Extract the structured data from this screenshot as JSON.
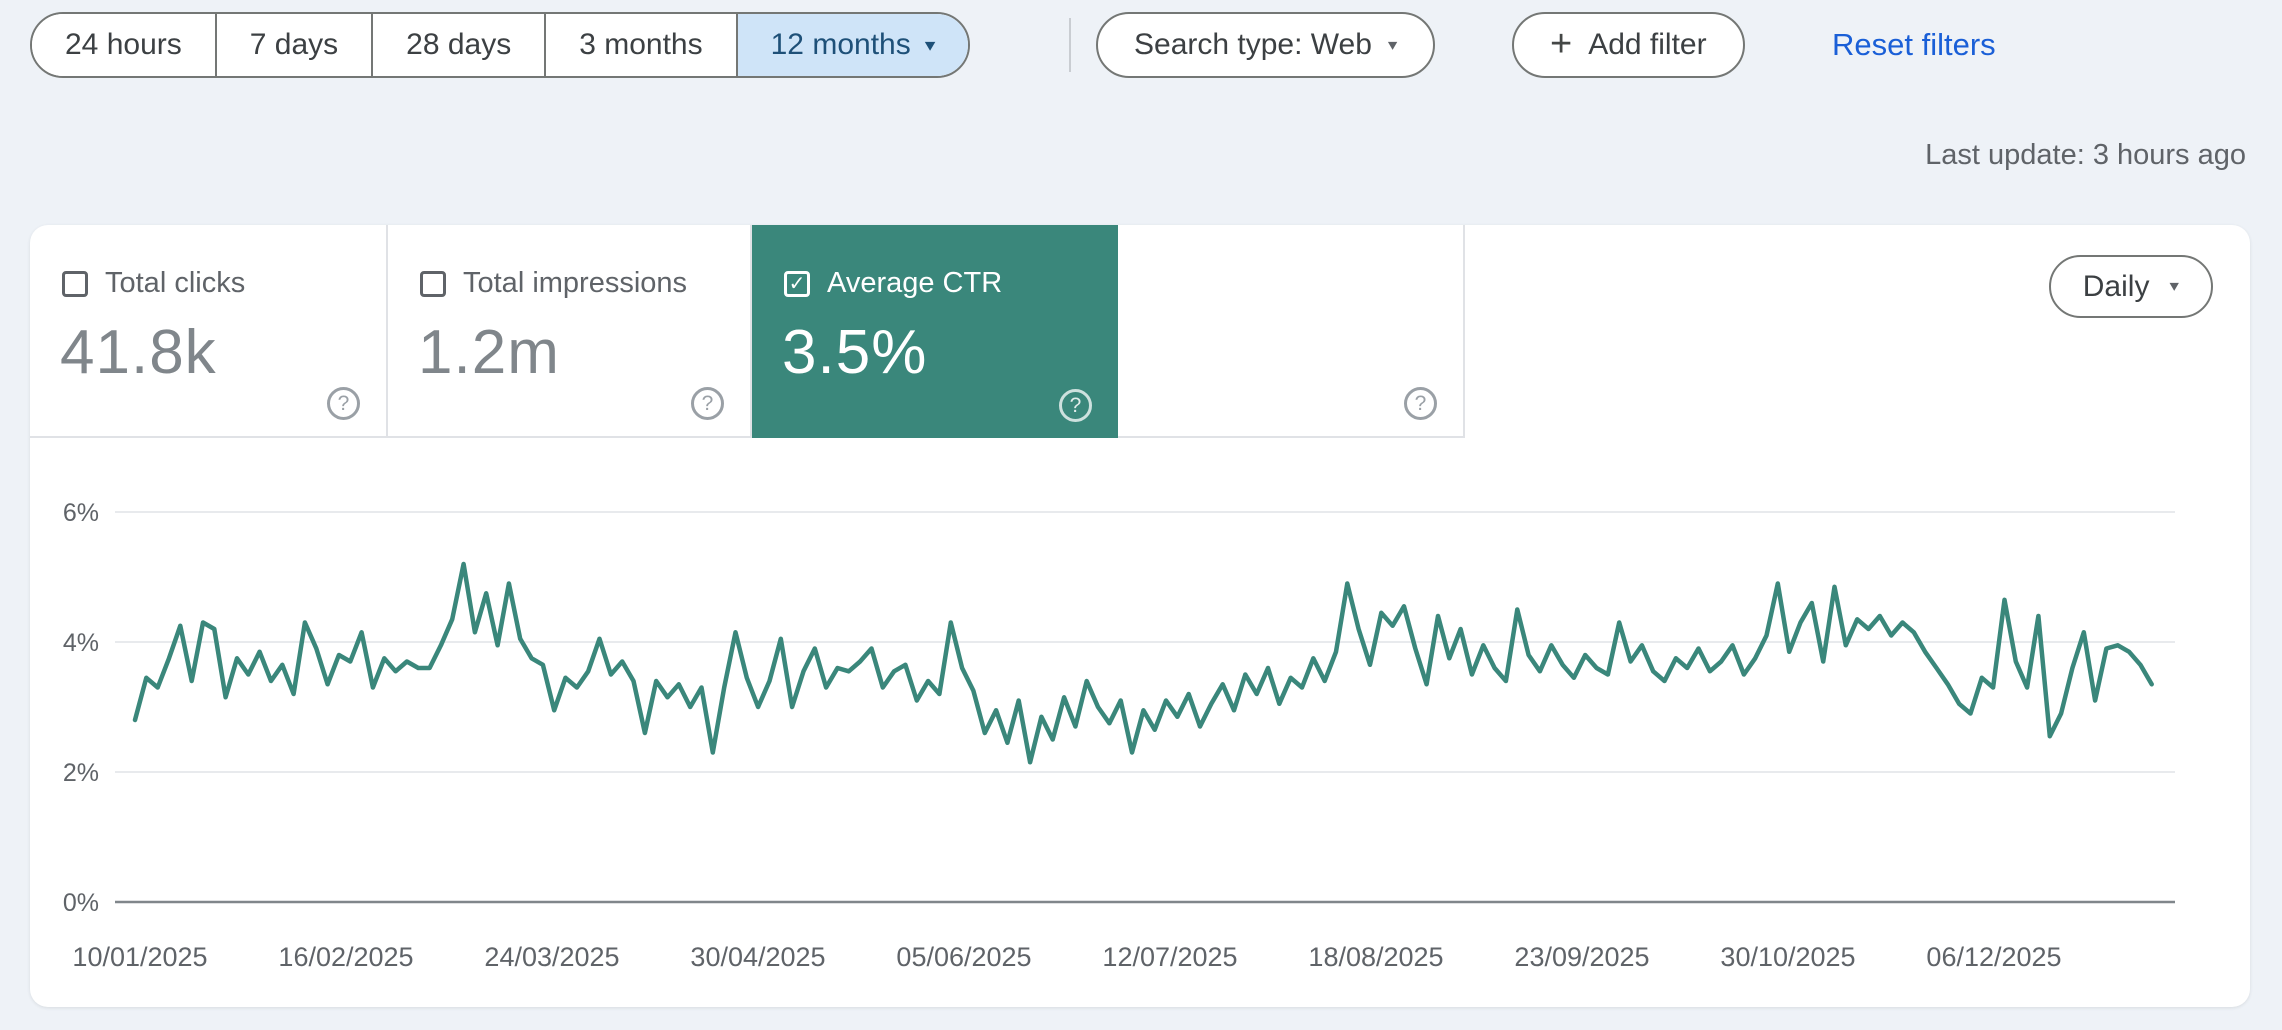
{
  "toolbar": {
    "ranges": [
      {
        "label": "24 hours",
        "selected": false
      },
      {
        "label": "7 days",
        "selected": false
      },
      {
        "label": "28 days",
        "selected": false
      },
      {
        "label": "3 months",
        "selected": false
      },
      {
        "label": "12 months",
        "selected": true
      }
    ],
    "search_type_label": "Search type: Web",
    "add_filter_label": "Add filter",
    "reset_filters_label": "Reset filters"
  },
  "last_update": "Last update: 3 hours ago",
  "metrics": {
    "cards": [
      {
        "label": "Total clicks",
        "value": "41.8k",
        "checked": false
      },
      {
        "label": "Total impressions",
        "value": "1.2m",
        "checked": false
      },
      {
        "label": "Average CTR",
        "value": "3.5%",
        "checked": true,
        "accent_color": "#3a877b"
      },
      {
        "label": "",
        "value": "",
        "checked": false
      }
    ]
  },
  "granularity": {
    "label": "Daily"
  },
  "icons": {
    "help": "?",
    "dropdown_arrow": "▾",
    "plus": "+",
    "check": "✓"
  },
  "colors": {
    "page_background": "#eef2f7",
    "card_background": "#ffffff",
    "ctr_teal": "#3a877b",
    "selected_chip_bg": "#cfe4f8",
    "selected_chip_text": "#1e5078",
    "link_blue": "#1a5fd7",
    "text_gray": "#5f6368",
    "value_gray": "#80868b",
    "gridline": "#e8eaed",
    "axis_line": "#80868b"
  },
  "chart_data": {
    "type": "line",
    "title": "Average CTR",
    "unit": "%",
    "color": "#3a877b",
    "legend_position": "none",
    "grid": true,
    "ylim": [
      0,
      6
    ],
    "y_ticks": [
      "0%",
      "2%",
      "4%",
      "6%"
    ],
    "x_ticks": [
      "10/01/2025",
      "16/02/2025",
      "24/03/2025",
      "30/04/2025",
      "05/06/2025",
      "12/07/2025",
      "18/08/2025",
      "23/09/2025",
      "30/10/2025",
      "06/12/2025"
    ],
    "x_range_dates": [
      "10/01/2025",
      "31/12/2025"
    ],
    "sampling_note": "daily CTR, values estimated from pixels at ~2-day intervals",
    "series": [
      {
        "name": "Average CTR (%)",
        "values": [
          2.8,
          3.45,
          3.3,
          3.75,
          4.25,
          3.4,
          4.3,
          4.2,
          3.15,
          3.75,
          3.5,
          3.85,
          3.4,
          3.65,
          3.2,
          4.3,
          3.9,
          3.35,
          3.8,
          3.7,
          4.15,
          3.3,
          3.75,
          3.55,
          3.7,
          3.6,
          3.6,
          3.95,
          4.35,
          5.2,
          4.15,
          4.75,
          3.95,
          4.9,
          4.05,
          3.75,
          3.65,
          2.95,
          3.45,
          3.3,
          3.55,
          4.05,
          3.5,
          3.7,
          3.4,
          2.6,
          3.4,
          3.15,
          3.35,
          3.0,
          3.3,
          2.3,
          3.3,
          4.15,
          3.45,
          3.0,
          3.4,
          4.05,
          3.0,
          3.55,
          3.9,
          3.3,
          3.6,
          3.55,
          3.7,
          3.9,
          3.3,
          3.55,
          3.65,
          3.1,
          3.4,
          3.2,
          4.3,
          3.6,
          3.25,
          2.6,
          2.95,
          2.45,
          3.1,
          2.15,
          2.85,
          2.5,
          3.15,
          2.7,
          3.4,
          3.0,
          2.75,
          3.1,
          2.3,
          2.95,
          2.65,
          3.1,
          2.85,
          3.2,
          2.7,
          3.05,
          3.35,
          2.95,
          3.5,
          3.2,
          3.6,
          3.05,
          3.45,
          3.3,
          3.75,
          3.4,
          3.85,
          4.9,
          4.2,
          3.65,
          4.45,
          4.25,
          4.55,
          3.9,
          3.35,
          4.4,
          3.75,
          4.2,
          3.5,
          3.95,
          3.6,
          3.4,
          4.5,
          3.8,
          3.55,
          3.95,
          3.65,
          3.45,
          3.8,
          3.6,
          3.5,
          4.3,
          3.7,
          3.95,
          3.55,
          3.4,
          3.75,
          3.6,
          3.9,
          3.55,
          3.7,
          3.95,
          3.5,
          3.75,
          4.1,
          4.9,
          3.85,
          4.3,
          4.6,
          3.7,
          4.85,
          3.95,
          4.35,
          4.2,
          4.4,
          4.1,
          4.3,
          4.15,
          3.85,
          3.6,
          3.35,
          3.05,
          2.9,
          3.45,
          3.3,
          4.65,
          3.7,
          3.3,
          4.4,
          2.55,
          2.9,
          3.6,
          4.15,
          3.1,
          3.9,
          3.95,
          3.85,
          3.65,
          3.35
        ]
      }
    ]
  }
}
